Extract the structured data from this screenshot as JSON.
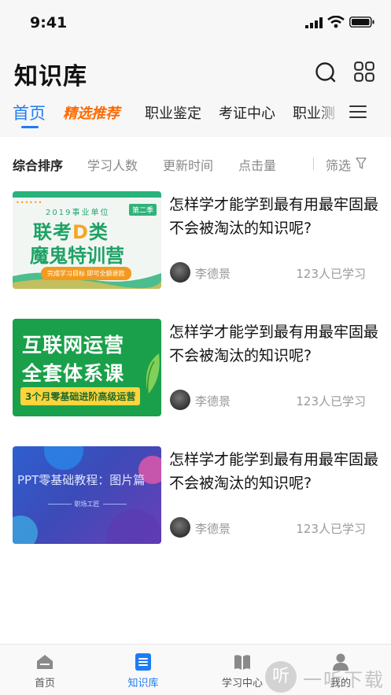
{
  "status": {
    "time": "9:41"
  },
  "header": {
    "title": "知识库",
    "tabs": [
      {
        "label": "首页",
        "active": true
      },
      {
        "label": "精选推荐",
        "featured": true
      },
      {
        "label": "职业鉴定"
      },
      {
        "label": "考证中心"
      },
      {
        "label": "职业测"
      }
    ]
  },
  "sortbar": {
    "options": [
      "综合排序",
      "学习人数",
      "更新时间",
      "点击量"
    ],
    "filter_label": "筛选"
  },
  "items": [
    {
      "title": "怎样学才能学到最有用最牢固最不会被淘汰的知识呢?",
      "author": "李德景",
      "learners": "123人已学习",
      "thumb": {
        "line1": "2019事业单位",
        "badge": "第二季",
        "line2a": "联考",
        "line2b": "D",
        "line2c": "类",
        "line3": "魔鬼特训营",
        "pill": "完成学习目标  即可全额退款"
      }
    },
    {
      "title": "怎样学才能学到最有用最牢固最不会被淘汰的知识呢?",
      "author": "李德景",
      "learners": "123人已学习",
      "thumb": {
        "line1": "互联网运营",
        "line2": "全套体系课",
        "bar": "3个月零基础进阶高级运营"
      }
    },
    {
      "title": "怎样学才能学到最有用最牢固最不会被淘汰的知识呢?",
      "author": "李德景",
      "learners": "123人已学习",
      "thumb": {
        "title": "PPT零基础教程：图片篇",
        "brand": "职场工匠"
      }
    }
  ],
  "bottomnav": {
    "items": [
      {
        "label": "首页"
      },
      {
        "label": "知识库",
        "active": true
      },
      {
        "label": "学习中心"
      },
      {
        "label": "我的"
      }
    ]
  },
  "watermark": {
    "glyph": "听",
    "text": "一听下载"
  },
  "colors": {
    "accent": "#1e7cf3",
    "featured": "#ff6a00"
  }
}
